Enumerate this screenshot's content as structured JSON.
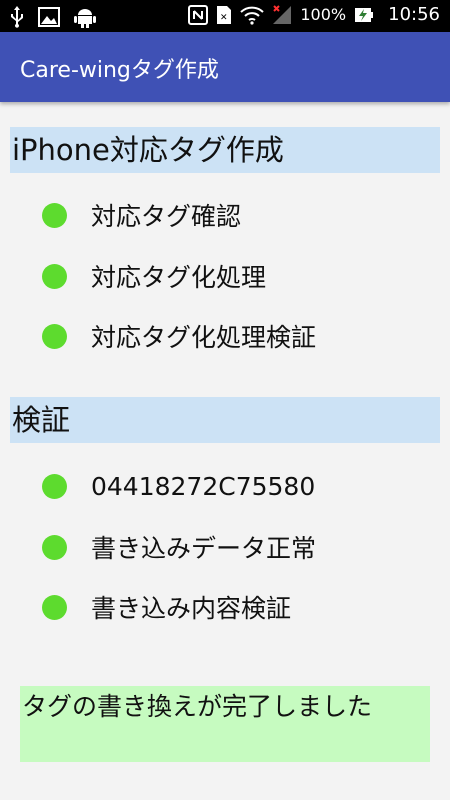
{
  "status_bar": {
    "left_icons": [
      "usb-icon",
      "image-icon",
      "android-icon"
    ],
    "right_icons": [
      "nfc-icon",
      "sim-icon",
      "wifi-icon",
      "signal-icon"
    ],
    "battery": "100%",
    "time": "10:56"
  },
  "app_bar": {
    "title": "Care-wingタグ作成",
    "color": "#3f51b5"
  },
  "sections": [
    {
      "header": "iPhone対応タグ作成",
      "items": [
        {
          "label": "対応タグ確認"
        },
        {
          "label": "対応タグ化処理"
        },
        {
          "label": "対応タグ化処理検証"
        }
      ]
    },
    {
      "header": "検証",
      "items": [
        {
          "label": "04418272C75580"
        },
        {
          "label": "書き込みデータ正常"
        },
        {
          "label": "書き込み内容検証"
        }
      ]
    }
  ],
  "status_dot_color": "#5ddb2e",
  "message": "タグの書き換えが完了しました"
}
